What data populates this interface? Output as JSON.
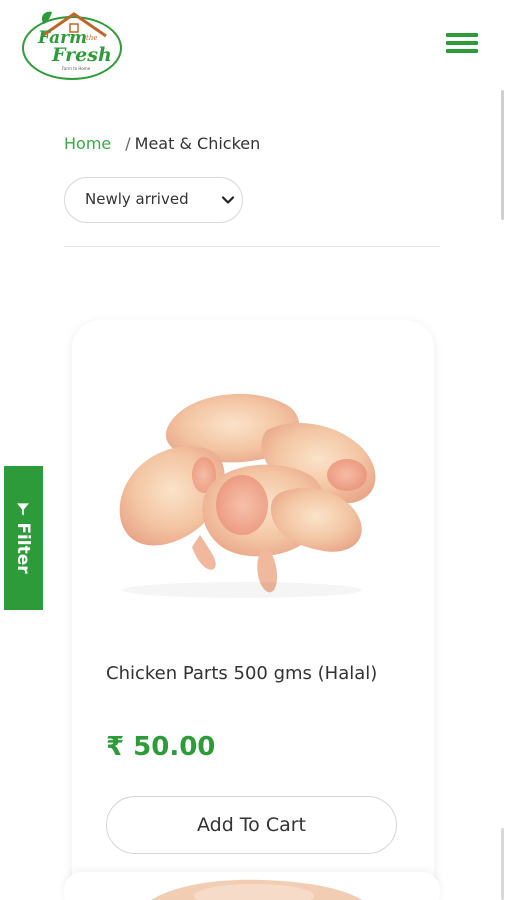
{
  "header": {
    "logo": {
      "line1": "Farm",
      "the": "the",
      "line2": "Fresh",
      "tagline": "Farm to Home"
    },
    "menu_icon": "hamburger-menu-icon"
  },
  "breadcrumb": {
    "home": "Home",
    "separator": "/",
    "current": "Meat & Chicken"
  },
  "sort": {
    "selected": "Newly arrived",
    "icon": "chevron-down-icon"
  },
  "product": {
    "name": "Chicken Parts 500 gms (Halal)",
    "price": "₹ 50.00",
    "add_to_cart": "Add To Cart",
    "image": "chicken-wings-photo"
  },
  "filter": {
    "label": "Filter",
    "icon": "filter-funnel-icon"
  },
  "colors": {
    "brand_green": "#2e9b3b",
    "link_green": "#3aa84a",
    "border": "#d9d9d9"
  }
}
